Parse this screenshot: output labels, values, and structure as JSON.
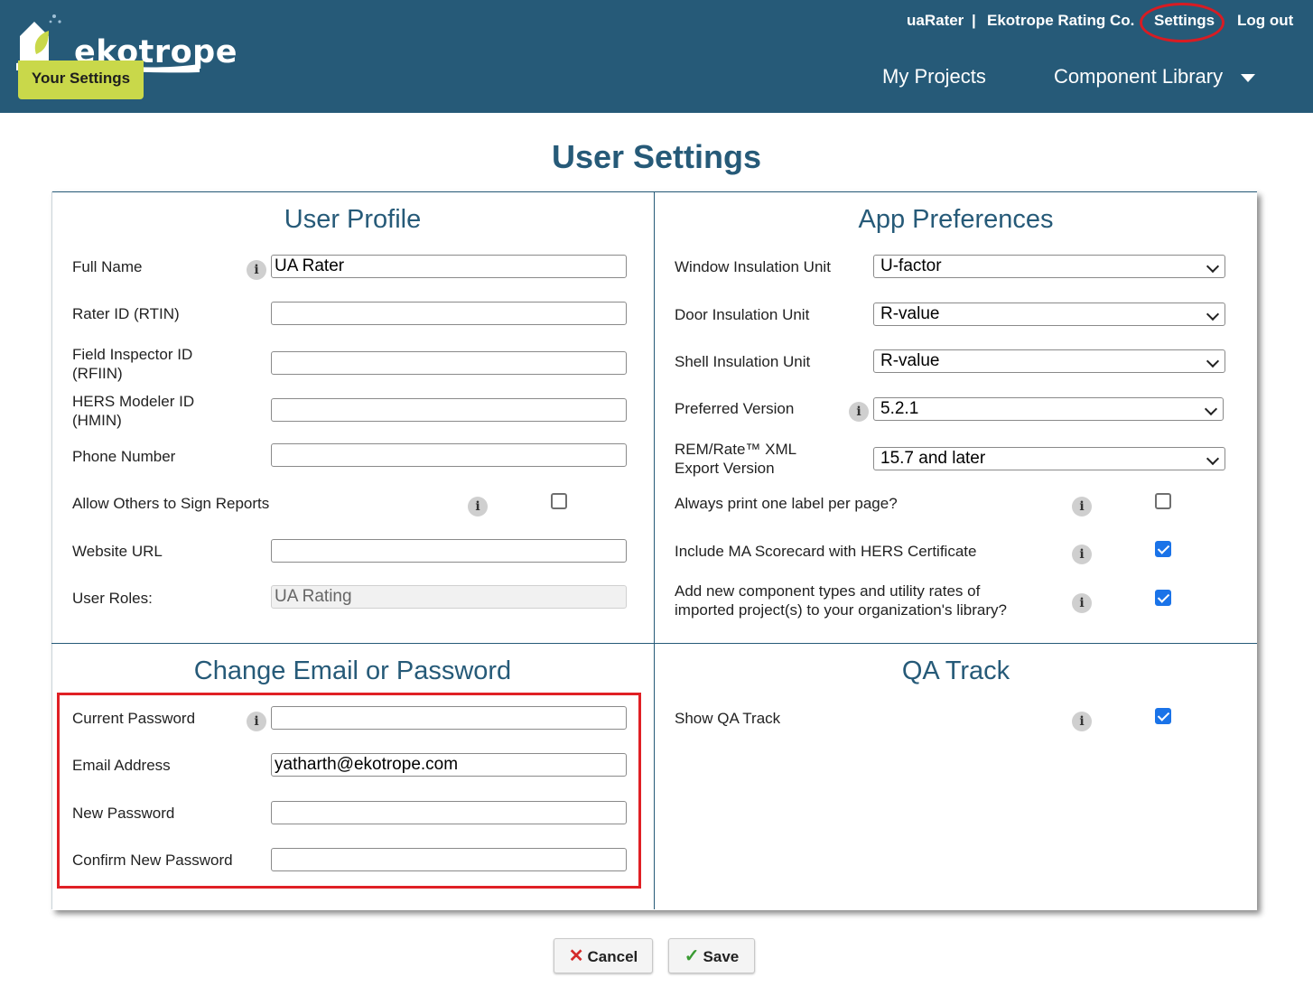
{
  "header": {
    "logo_text": "ekotrope",
    "your_settings": "Your Settings",
    "user": "uaRater",
    "separator": "|",
    "company": "Ekotrope Rating Co.",
    "settings": "Settings",
    "logout": "Log out",
    "nav_projects": "My Projects",
    "nav_library": "Component Library"
  },
  "page_title": "User Settings",
  "user_profile": {
    "title": "User Profile",
    "full_name_label": "Full Name",
    "full_name_value": "UA Rater",
    "rater_id_label": "Rater ID (RTIN)",
    "field_inspector_label_1": "Field Inspector ID",
    "field_inspector_label_2": "(RFIIN)",
    "hers_modeler_label_1": "HERS Modeler ID",
    "hers_modeler_label_2": "(HMIN)",
    "phone_label": "Phone Number",
    "allow_sign_label": "Allow Others to Sign Reports",
    "allow_sign_checked": false,
    "website_label": "Website URL",
    "roles_label": "User Roles:",
    "roles_value": "UA Rating"
  },
  "app_preferences": {
    "title": "App Preferences",
    "window_label": "Window Insulation Unit",
    "window_value": "U-factor",
    "door_label": "Door Insulation Unit",
    "door_value": "R-value",
    "shell_label": "Shell Insulation Unit",
    "shell_value": "R-value",
    "version_label": "Preferred Version",
    "version_value": "5.2.1",
    "remrate_label_1": "REM/Rate™ XML",
    "remrate_label_2": "Export Version",
    "remrate_value": "15.7 and later",
    "label_per_page": "Always print one label per page?",
    "label_per_page_checked": false,
    "ma_scorecard": "Include MA Scorecard with HERS Certificate",
    "ma_scorecard_checked": true,
    "add_component_1": "Add new component types and utility rates of",
    "add_component_2": "imported project(s) to your organization's library?",
    "add_component_checked": true
  },
  "change_email": {
    "title": "Change Email or Password",
    "current_password_label": "Current Password",
    "email_label": "Email Address",
    "email_value": "yatharth@ekotrope.com",
    "new_password_label": "New Password",
    "confirm_password_label": "Confirm New Password"
  },
  "qa_track": {
    "title": "QA Track",
    "show_label": "Show QA Track",
    "show_checked": true
  },
  "buttons": {
    "cancel": "Cancel",
    "save": "Save"
  },
  "info_glyph": "i",
  "colors": {
    "header_bg": "#265a78",
    "accent_green": "#c9d84a",
    "highlight_red": "#e02025",
    "checkbox_blue": "#1a73e8"
  }
}
